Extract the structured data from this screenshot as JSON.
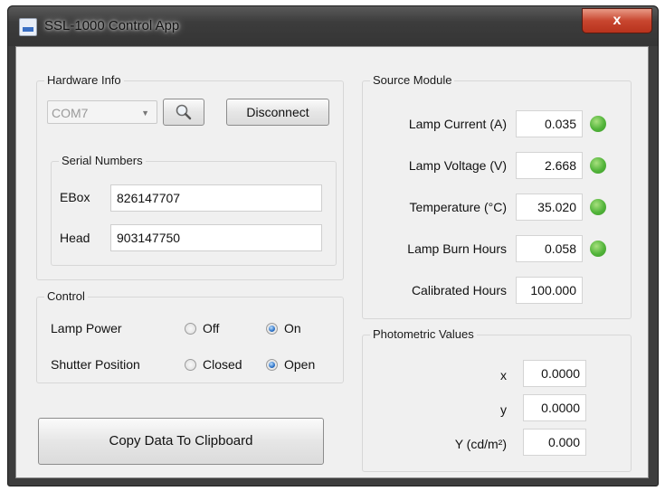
{
  "window": {
    "title": "SSL-1000 Control App",
    "close_glyph": "x"
  },
  "hardware": {
    "group_title": "Hardware Info",
    "com_port": "COM7",
    "search_icon": "magnifier-icon",
    "disconnect_label": "Disconnect",
    "serial_group_title": "Serial Numbers",
    "ebox_label": "EBox",
    "ebox_value": "826147707",
    "head_label": "Head",
    "head_value": "903147750"
  },
  "control": {
    "group_title": "Control",
    "lamp_power_label": "Lamp Power",
    "lamp_off": "Off",
    "lamp_on": "On",
    "lamp_power_selected": "On",
    "shutter_label": "Shutter Position",
    "shutter_closed": "Closed",
    "shutter_open": "Open",
    "shutter_selected": "Open"
  },
  "copy_button_label": "Copy Data To Clipboard",
  "source": {
    "group_title": "Source Module",
    "rows": [
      {
        "label": "Lamp Current (A)",
        "value": "0.035",
        "status": "ok"
      },
      {
        "label": "Lamp Voltage (V)",
        "value": "2.668",
        "status": "ok"
      },
      {
        "label": "Temperature (°C)",
        "value": "35.020",
        "status": "ok"
      },
      {
        "label": "Lamp Burn Hours",
        "value": "0.058",
        "status": "ok"
      },
      {
        "label": "Calibrated Hours",
        "value": "100.000"
      }
    ],
    "led_color": "#52b43a"
  },
  "photometric": {
    "group_title": "Photometric Values",
    "x_label": "x",
    "x_value": "0.0000",
    "y_label": "y",
    "y_value": "0.0000",
    "Y_label": "Y (cd/m²)",
    "Y_value": "0.000"
  }
}
